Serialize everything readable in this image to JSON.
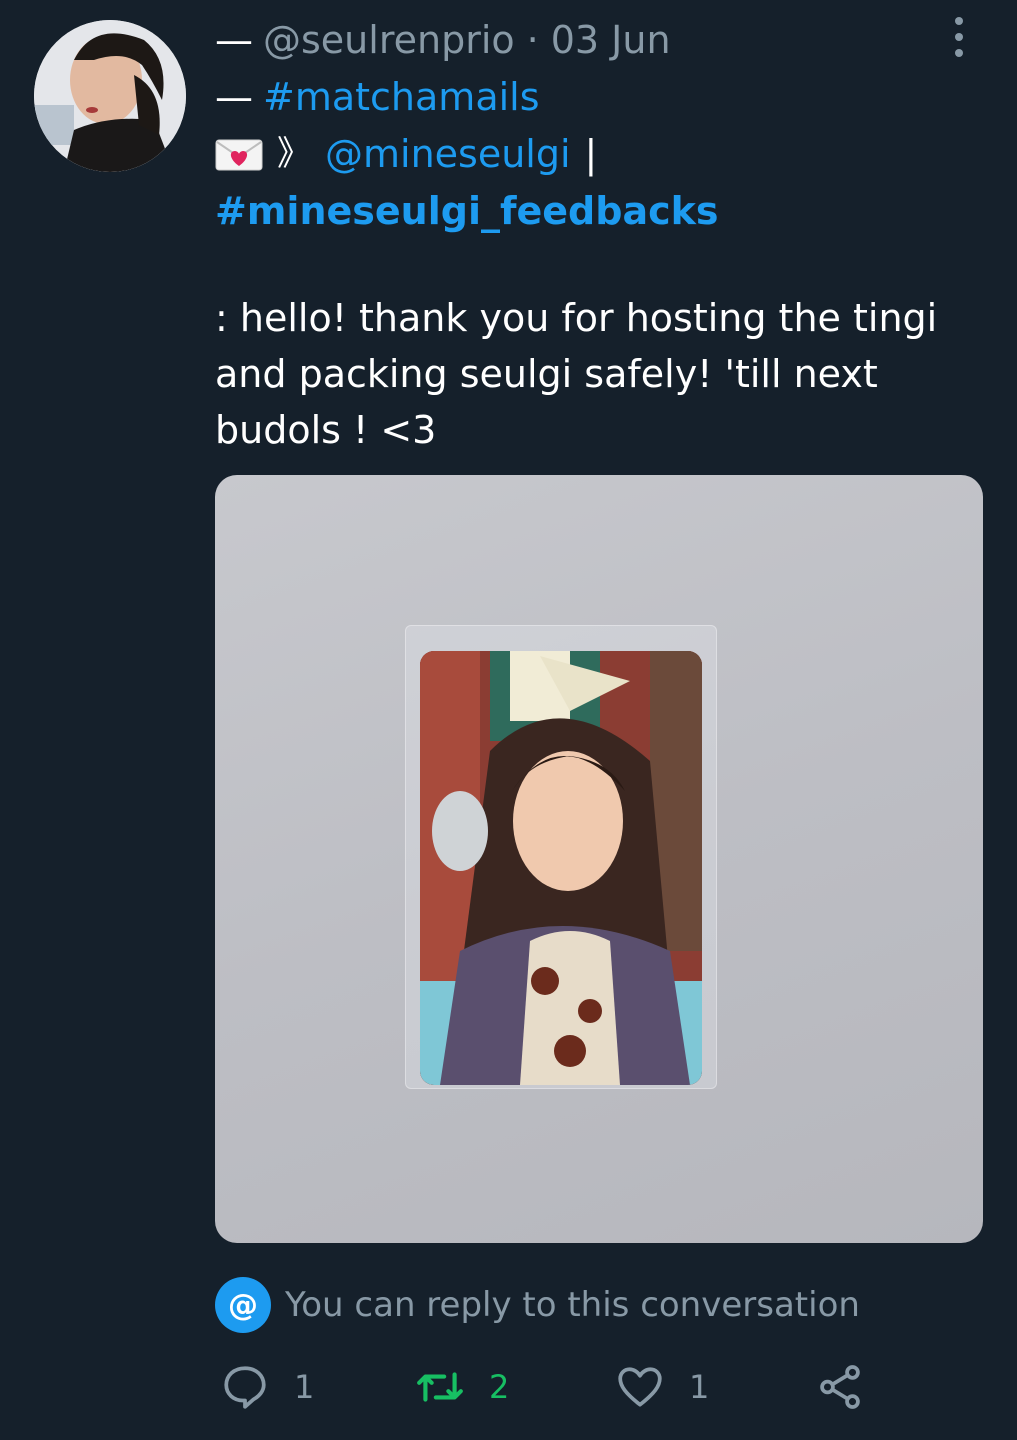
{
  "tweet": {
    "author_handle": "@seulrenprio",
    "date": "03 Jun",
    "prefix_dash": "—",
    "hashtag_top": "#matchamails",
    "arrow": "》",
    "mention": "@mineseulgi",
    "pipe": "|",
    "hashtag_bold": "#mineseulgi_feedbacks",
    "body": ": hello! thank you for hosting the tingi\nand packing seulgi safely! 'till next\nbudols ! <3"
  },
  "reply_hint": {
    "icon": "@",
    "text": "You can reply to this conversation"
  },
  "actions": {
    "replies": "1",
    "retweets": "2",
    "likes": "1"
  },
  "colors": {
    "background": "#15202b",
    "link": "#1d9bf0",
    "muted": "#8899a6",
    "retweet": "#17bf63"
  }
}
